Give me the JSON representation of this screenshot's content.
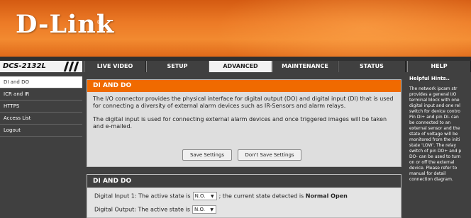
{
  "brand": {
    "logo": "D-Link",
    "reg": "®"
  },
  "model": "DCS-2132L",
  "tabs": [
    {
      "label": "LIVE VIDEO"
    },
    {
      "label": "SETUP"
    },
    {
      "label": "ADVANCED"
    },
    {
      "label": "MAINTENANCE"
    },
    {
      "label": "STATUS"
    },
    {
      "label": "HELP"
    }
  ],
  "sidebar": {
    "items": [
      {
        "label": "DI and DO"
      },
      {
        "label": "ICR and IR"
      },
      {
        "label": "HTTPS"
      },
      {
        "label": "Access List"
      },
      {
        "label": "Logout"
      }
    ]
  },
  "panel1": {
    "title": "DI AND DO",
    "para1": "The I/O connector provides the physical interface for digital output (DO) and digital input (DI) that is used for connecting a diversity of external alarm devices such as IR-Sensors and alarm relays.",
    "para2": "The digital input is used for connecting external alarm devices and once triggered images will be taken and e-mailed.",
    "save_label": "Save Settings",
    "dont_save_label": "Don't Save Settings"
  },
  "panel2": {
    "title": "DI AND DO",
    "di_prefix": "Digital Input 1: The active state is",
    "di_value": "N.O.",
    "di_mid": "; the current state detected is",
    "di_state": "Normal Open",
    "do_prefix": "Digital Output: The active state is",
    "do_value": "N.O."
  },
  "help": {
    "title": "Helpful Hints..",
    "text": "The network ipcam str\nprovides a general I/O\nterminal block with one\ndigital input and one rel\nswitch for device contro\nPin DI+ and pin DI- can\nbe connected to an\nexternal sensor and the\nstate of voltage will be\nmonitored from the initi\nstate 'LOW'. The relay\nswitch of pin DO+ and p\nDO- can be used to turn\non or off the external\ndevice. Please refer to\nmanual for detail\nconnection diagram."
  },
  "colors": {
    "accent": "#f06a00",
    "dark": "#404040"
  }
}
